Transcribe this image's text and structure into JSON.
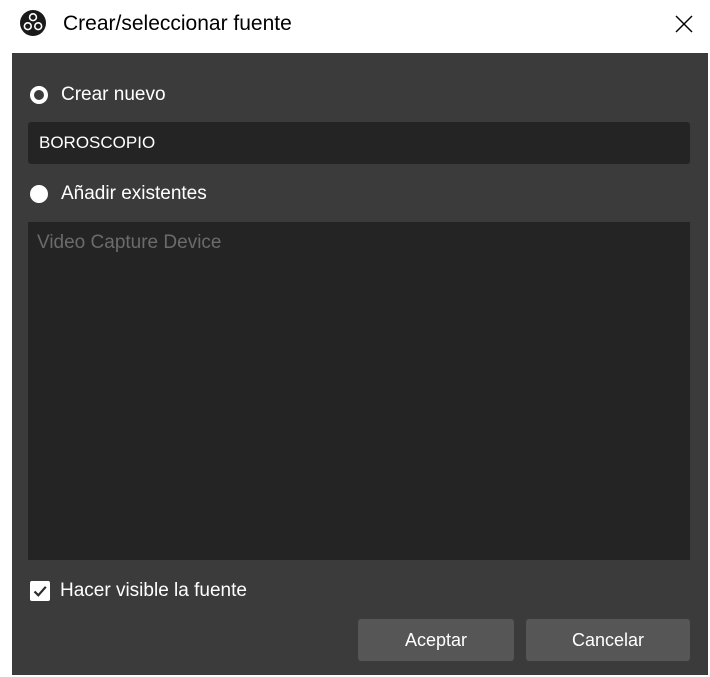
{
  "window": {
    "title": "Crear/seleccionar fuente",
    "icon": "obs-logo-icon",
    "close_icon": "close-icon"
  },
  "create_new": {
    "label": "Crear nuevo",
    "selected": true
  },
  "name_input": {
    "value": "BOROSCOPIO"
  },
  "add_existing": {
    "label": "Añadir existentes",
    "selected": false
  },
  "existing_sources": {
    "items": [
      "Video Capture Device"
    ]
  },
  "visible_checkbox": {
    "label": "Hacer visible la fuente",
    "checked": true
  },
  "buttons": {
    "ok": "Aceptar",
    "cancel": "Cancelar"
  },
  "colors": {
    "dialog_bg": "#3b3b3b",
    "field_bg": "#242424",
    "button_bg": "#565656",
    "text": "#ffffff",
    "disabled_text": "#6b6b6b"
  }
}
